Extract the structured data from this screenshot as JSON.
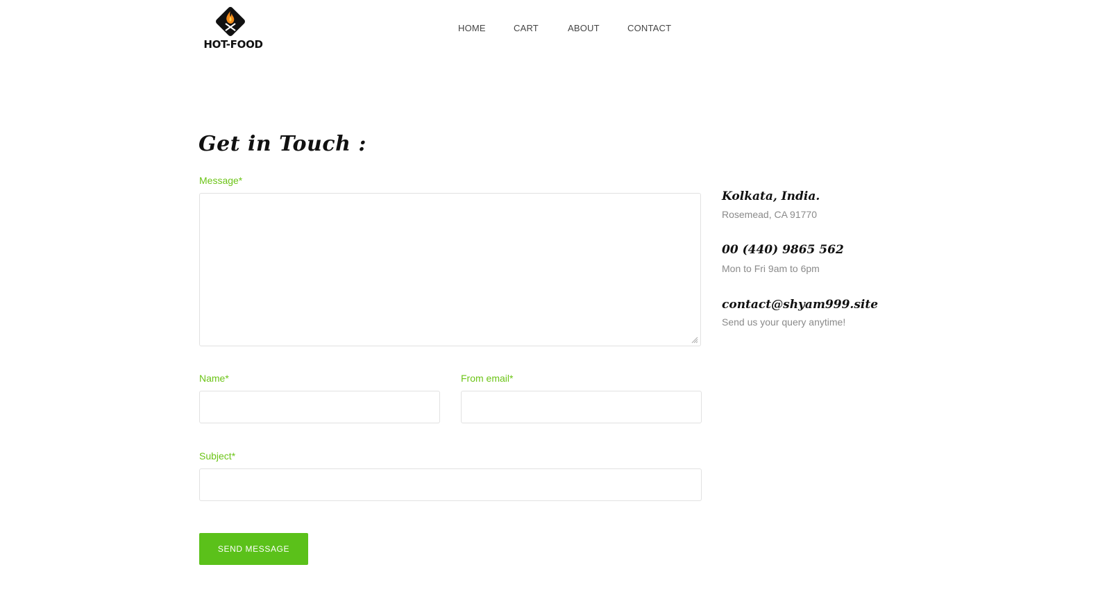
{
  "brand": {
    "name": "HOT-FOOD"
  },
  "nav": {
    "items": [
      "HOME",
      "CART",
      "ABOUT",
      "CONTACT"
    ]
  },
  "page": {
    "title": "Get in Touch :"
  },
  "form": {
    "message_label": "Message*",
    "name_label": "Name*",
    "email_label": "From email*",
    "subject_label": "Subject*",
    "message_value": "",
    "name_value": "",
    "email_value": "",
    "subject_value": "",
    "submit_label": "SEND MESSAGE"
  },
  "contact_info": [
    {
      "title": "Kolkata, India.",
      "subtitle": "Rosemead, CA 91770"
    },
    {
      "title": "00 (440) 9865 562",
      "subtitle": "Mon to Fri 9am to 6pm"
    },
    {
      "title": "contact@shyam999.site",
      "subtitle": "Send us your query anytime!"
    }
  ],
  "colors": {
    "accent": "#5bc11a",
    "label": "#6cc417",
    "muted": "#8a8a8a",
    "flame": "#f28a1a"
  }
}
